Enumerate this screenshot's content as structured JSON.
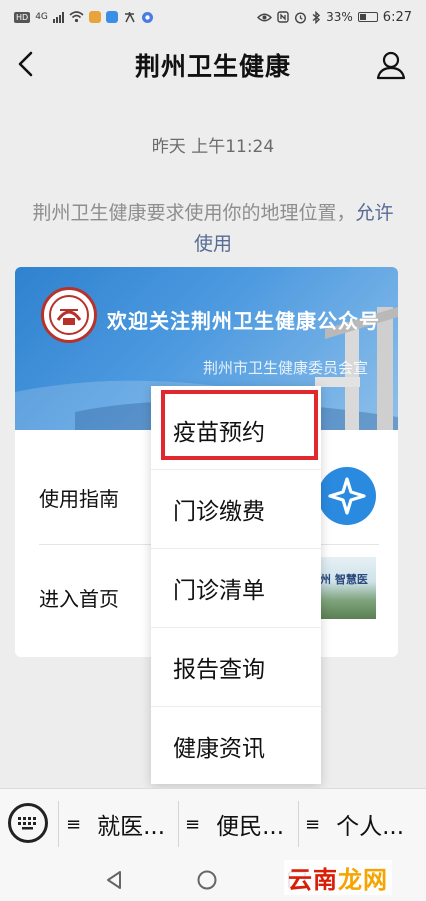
{
  "status_bar": {
    "network_badge": "HD",
    "net_type": "4G",
    "battery": "33%",
    "time": "6:27"
  },
  "header": {
    "title": "荆州卫生健康"
  },
  "chat": {
    "timestamp": "昨天 上午11:24",
    "location_prompt": "荆州卫生健康要求使用你的地理位置，",
    "allow_link": "允许使用"
  },
  "card": {
    "banner_title": "欢迎关注荆州卫生健康公众号",
    "banner_subtitle": "荆州市卫生健康委员会宣",
    "items": [
      {
        "label": "使用指南"
      },
      {
        "label": "进入首页"
      }
    ],
    "photo_text": "州 智慧医"
  },
  "popup_menu": {
    "items": [
      {
        "label": "疫苗预约"
      },
      {
        "label": "门诊缴费"
      },
      {
        "label": "门诊清单"
      },
      {
        "label": "报告查询"
      },
      {
        "label": "健康资讯"
      }
    ],
    "highlight_color": "#e0282e"
  },
  "bottom_menu": {
    "items": [
      {
        "label": "就医..."
      },
      {
        "label": "便民..."
      },
      {
        "label": "个人..."
      }
    ]
  },
  "watermark": {
    "text_main": "云南",
    "text_accent": "龙网"
  },
  "colors": {
    "link": "#576b95",
    "banner_blue": "#2f82cf",
    "background": "#ededed"
  }
}
